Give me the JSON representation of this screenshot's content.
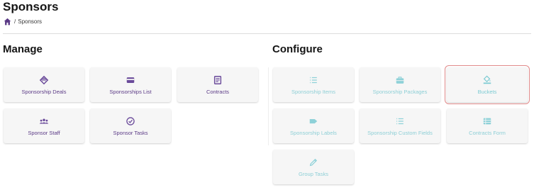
{
  "header": {
    "title": "Sponsors"
  },
  "breadcrumb": {
    "separator": "/",
    "current": "Sponsors"
  },
  "colors": {
    "manage_accent": "#6a4a9a",
    "configure_accent": "#8ed1d8",
    "highlight_border": "#e08a8a"
  },
  "manage": {
    "title": "Manage",
    "cards": [
      {
        "label": "Sponsorship Deals",
        "icon": "handshake-icon"
      },
      {
        "label": "Sponsorships List",
        "icon": "card-list-icon"
      },
      {
        "label": "Contracts",
        "icon": "contract-icon"
      },
      {
        "label": "Sponsor Staff",
        "icon": "users-icon"
      },
      {
        "label": "Sponsor Tasks",
        "icon": "check-circle-icon"
      }
    ]
  },
  "configure": {
    "title": "Configure",
    "cards": [
      {
        "label": "Sponsorship Items",
        "icon": "list-icon"
      },
      {
        "label": "Sponsorship Packages",
        "icon": "briefcase-icon"
      },
      {
        "label": "Buckets",
        "icon": "paint-bucket-icon"
      },
      {
        "label": "Sponsorship Labels",
        "icon": "tag-icon"
      },
      {
        "label": "Sponsorship Custom Fields",
        "icon": "list-icon"
      },
      {
        "label": "Contracts Form",
        "icon": "table-list-icon"
      },
      {
        "label": "Group Tasks",
        "icon": "pencil-icon"
      }
    ]
  }
}
